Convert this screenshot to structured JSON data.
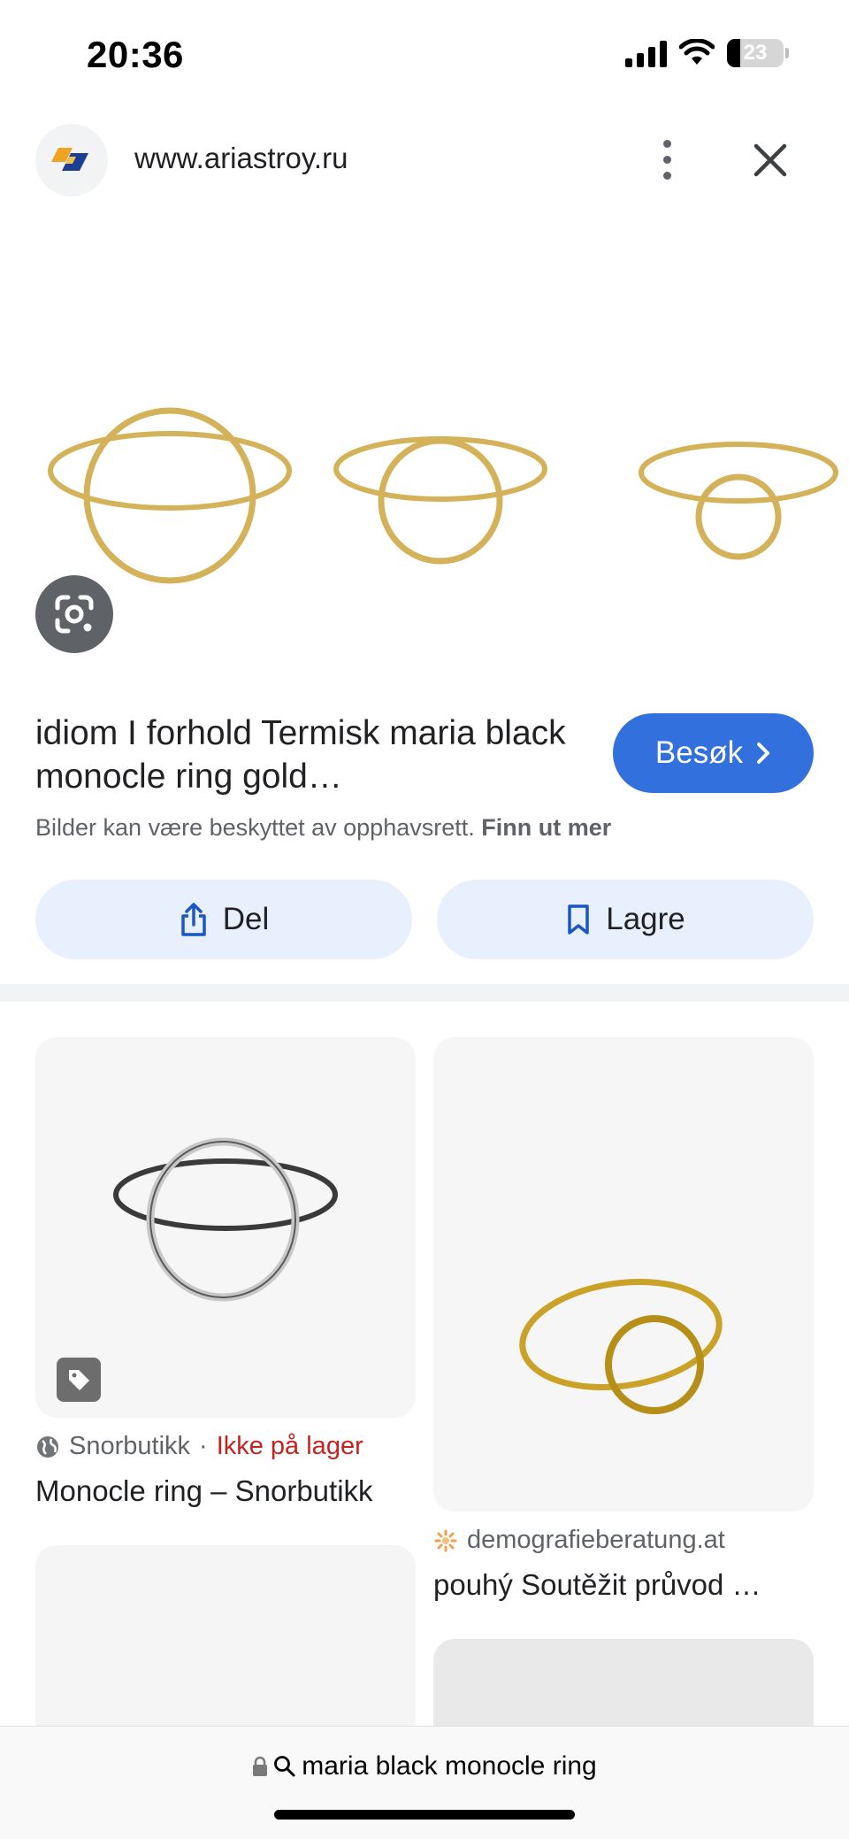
{
  "status_bar": {
    "time": "20:36",
    "battery_percent": "23",
    "battery_level": 0.23
  },
  "header": {
    "url": "www.ariastroy.ru",
    "favicon": "ariastroy-logo-icon",
    "more_icon": "more-vert-icon",
    "close_icon": "close-icon"
  },
  "result": {
    "title": "idiom I forhold Termisk maria black monocle ring gold…",
    "visit_label": "Besøk",
    "copyright_text": "Bilder kan være beskyttet av opphavsrett.",
    "learn_more": "Finn ut mer"
  },
  "actions": {
    "share_label": "Del",
    "save_label": "Lagre"
  },
  "related": [
    {
      "source": "Snorbutikk",
      "separator": "·",
      "stock": "Ikke på lager",
      "title": "Monocle ring – Snorbutikk"
    },
    {
      "source": "demografieberatung.at",
      "title": "pouhý Soutěžit průvod …"
    }
  ],
  "bottom_bar": {
    "query": "maria black monocle ring"
  },
  "colors": {
    "accent": "#3270de",
    "action_bg": "#e8effd",
    "stock_red": "#c5221f",
    "gold": "#d4b25a"
  }
}
